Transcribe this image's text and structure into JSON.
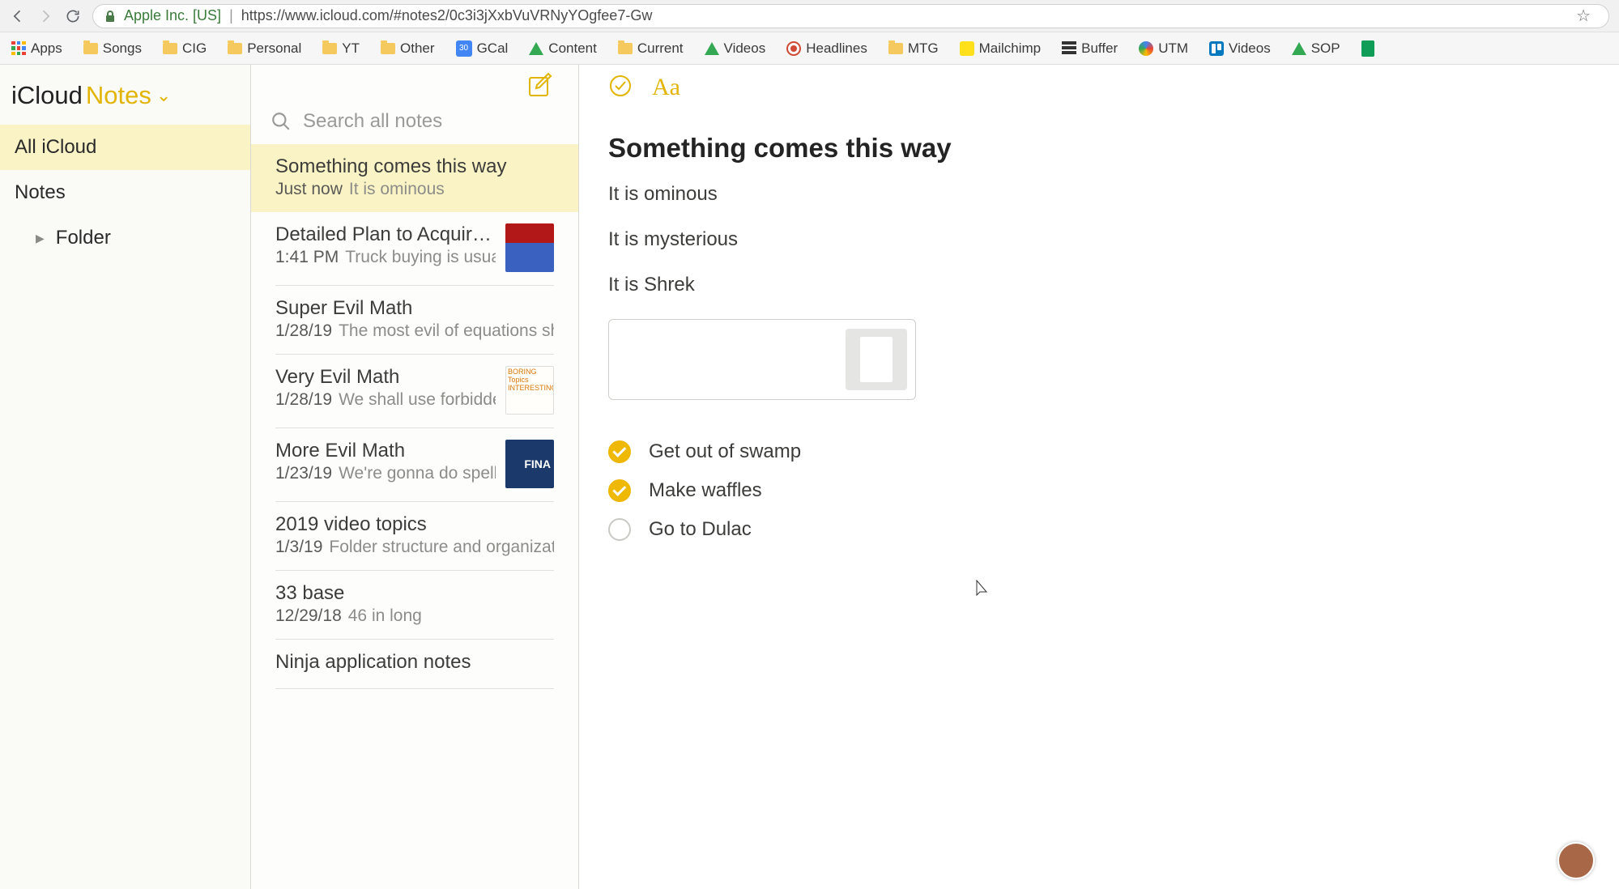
{
  "browser": {
    "site_label": "Apple Inc. [US]",
    "url": "https://www.icloud.com/#notes2/0c3i3jXxbVuVRNyYOgfee7-Gw"
  },
  "bookmarks": [
    {
      "label": "Apps",
      "icon": "apps"
    },
    {
      "label": "Songs",
      "icon": "folder"
    },
    {
      "label": "CIG",
      "icon": "folder"
    },
    {
      "label": "Personal",
      "icon": "folder"
    },
    {
      "label": "YT",
      "icon": "folder"
    },
    {
      "label": "Other",
      "icon": "folder"
    },
    {
      "label": "GCal",
      "icon": "gcal",
      "badge": "30"
    },
    {
      "label": "Content",
      "icon": "gdrive"
    },
    {
      "label": "Current",
      "icon": "folder"
    },
    {
      "label": "Videos",
      "icon": "gdrive"
    },
    {
      "label": "Headlines",
      "icon": "bullseye"
    },
    {
      "label": "MTG",
      "icon": "folder"
    },
    {
      "label": "Mailchimp",
      "icon": "mailchimp"
    },
    {
      "label": "Buffer",
      "icon": "buffer"
    },
    {
      "label": "UTM",
      "icon": "utm"
    },
    {
      "label": "Videos",
      "icon": "trello"
    },
    {
      "label": "SOP",
      "icon": "gdrive"
    }
  ],
  "app": {
    "name_part1": "iCloud",
    "name_part2": "Notes"
  },
  "sidebar": {
    "items": [
      {
        "label": "All iCloud",
        "selected": true
      },
      {
        "label": "Notes"
      },
      {
        "label": "Folder",
        "expandable": true
      }
    ]
  },
  "search": {
    "placeholder": "Search all notes"
  },
  "notes": [
    {
      "title": "Something comes this way",
      "time": "Just now",
      "preview": "It is ominous",
      "selected": true,
      "thumb": null
    },
    {
      "title": "Detailed Plan to Acquire a F…",
      "time": "1:41 PM",
      "preview": "Truck buying is usually …",
      "thumb": "spidey"
    },
    {
      "title": "Super Evil Math",
      "time": "1/28/19",
      "preview": "The most evil of equations shal…",
      "thumb": null
    },
    {
      "title": "Very Evil Math",
      "time": "1/28/19",
      "preview": "We shall use forbidden …",
      "thumb": "boring"
    },
    {
      "title": "More Evil Math",
      "time": "1/23/19",
      "preview": "We're gonna do spells, …",
      "thumb": "fina"
    },
    {
      "title": "2019 video topics",
      "time": "1/3/19",
      "preview": "Folder structure and organization",
      "thumb": null
    },
    {
      "title": "33 base",
      "time": "12/29/18",
      "preview": "46 in long",
      "thumb": null
    },
    {
      "title": "Ninja application notes",
      "time": "",
      "preview": "",
      "thumb": null
    }
  ],
  "editor": {
    "title": "Something comes this way",
    "body": [
      "It is ominous",
      "It is mysterious",
      "It is Shrek"
    ],
    "checklist": [
      {
        "label": "Get out of swamp",
        "checked": true
      },
      {
        "label": "Make waffles",
        "checked": true
      },
      {
        "label": "Go to Dulac",
        "checked": false
      }
    ]
  }
}
